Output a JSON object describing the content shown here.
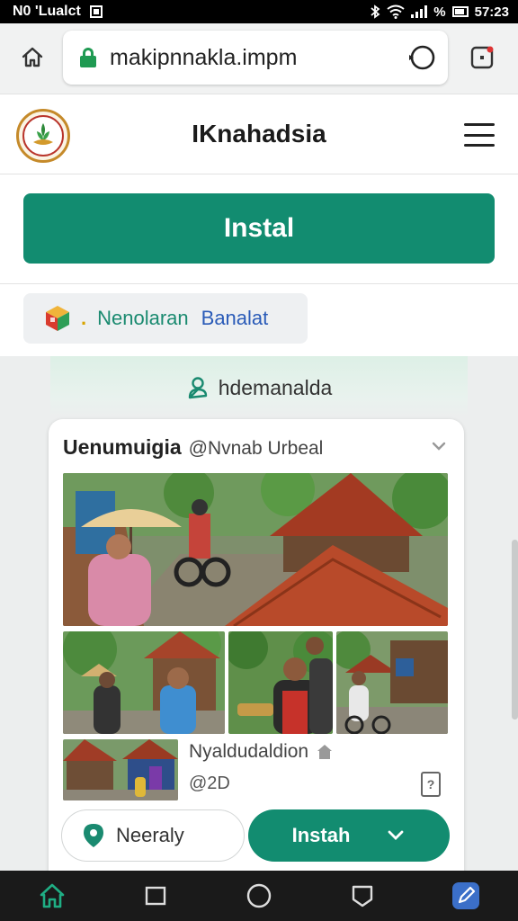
{
  "status_bar": {
    "left_text": "N0 'Lualct",
    "battery_text": "%",
    "time": "57:23"
  },
  "browser": {
    "url": "makipnnakla.impm"
  },
  "site": {
    "title": "IKnahadsia"
  },
  "install_button": {
    "label": "Instal"
  },
  "chip": {
    "dot": ".",
    "label_green": "Nenolaran",
    "label_blue": "Banalat"
  },
  "location": {
    "label": "hdemanalda"
  },
  "card": {
    "title": "Uenumuigia",
    "handle": "@Nvnab Urbeal",
    "caption_name": "Nyaldudaldion",
    "caption_count": "@2D",
    "nearby_label": "Neeraly",
    "install_label": "Instah"
  },
  "colors": {
    "accent_green": "#128c70",
    "link_blue": "#2a5bb8",
    "nav_bg": "#1a1a1a"
  }
}
